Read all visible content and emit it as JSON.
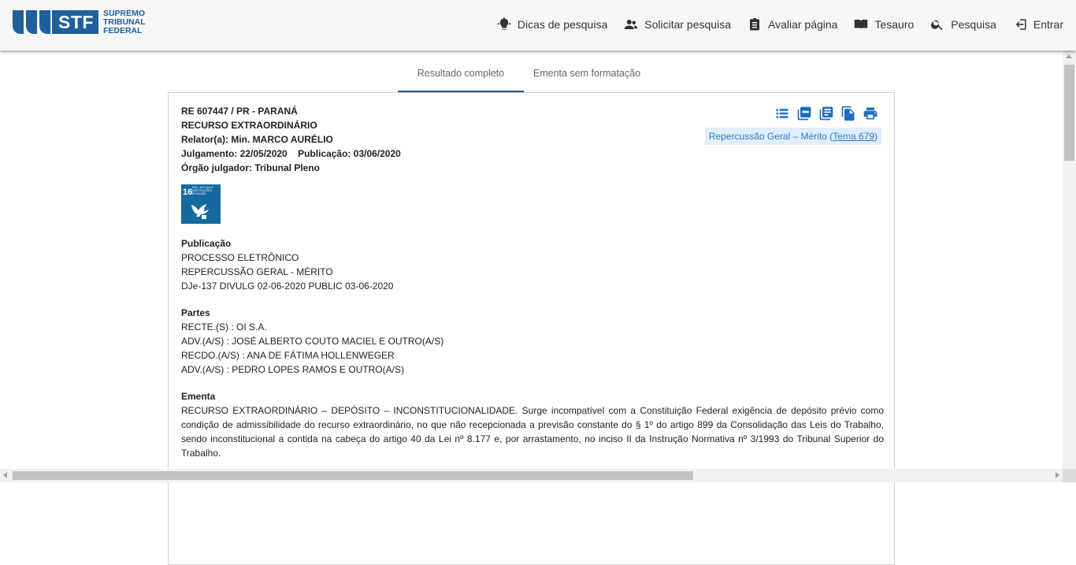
{
  "header": {
    "logo": {
      "abbr": "STF",
      "line1": "SUPREMO",
      "line2": "TRIBUNAL",
      "line3": "FEDERAL",
      "color": "#1f5f9e"
    },
    "nav": [
      {
        "label": "Dicas de pesquisa",
        "icon": "lightbulb-icon"
      },
      {
        "label": "Solicitar pesquisa",
        "icon": "people-icon"
      },
      {
        "label": "Avaliar página",
        "icon": "clipboard-icon"
      },
      {
        "label": "Tesauro",
        "icon": "book-icon"
      },
      {
        "label": "Pesquisa",
        "icon": "search-icon"
      },
      {
        "label": "Entrar",
        "icon": "login-icon"
      }
    ]
  },
  "tabs": [
    {
      "label": "Resultado completo",
      "active": true
    },
    {
      "label": "Ementa sem formatação",
      "active": false
    }
  ],
  "document": {
    "case": "RE 607447 / PR - PARANÁ",
    "type": "RECURSO EXTRAORDINÁRIO",
    "relator": "Relator(a): Min. MARCO AURÉLIO",
    "julgamento": "Julgamento: 22/05/2020",
    "publicacao_date": "Publicação: 03/06/2020",
    "orgao": "Órgão julgador: Tribunal Pleno",
    "ods": {
      "number": "16",
      "label": "PAZ, JUSTIÇA E INSTITUIÇÕES EFICAZES",
      "icon": "dove-icon",
      "color": "#136a9f"
    },
    "badge": {
      "text": "Repercussão Geral – Mérito (",
      "link": "Tema 679",
      "close": ")"
    },
    "actions": [
      "list-icon",
      "pdf-icon",
      "document-icon",
      "copy-icon",
      "print-icon"
    ],
    "publicacao": {
      "title": "Publicação",
      "lines": [
        "PROCESSO ELETRÔNICO",
        "REPERCUSSÃO GERAL - MÉRITO",
        "DJe-137  DIVULG 02-06-2020  PUBLIC 03-06-2020"
      ]
    },
    "partes": {
      "title": "Partes",
      "lines": [
        "RECTE.(S)  : OI S.A.",
        "ADV.(A/S)  : JOSÉ ALBERTO COUTO MACIEL E OUTRO(A/S)",
        "RECDO.(A/S)  : ANA DE FÁTIMA HOLLENWEGER",
        "ADV.(A/S)  : PEDRO LOPES RAMOS E OUTRO(A/S)"
      ]
    },
    "ementa": {
      "title": "Ementa",
      "text": "RECURSO EXTRAORDINÁRIO – DEPÓSITO – INCONSTITUCIONALIDADE. Surge incompatível com a Constituição Federal exigência de depósito prévio como condição de admissibilidade do recurso extraordinário, no que não recepcionada a previsão constante do § 1º do artigo 899 da Consolidação das Leis do Trabalho, sendo inconstitucional a contida na cabeça do artigo 40 da Lei nº 8.177 e, por arrastamento, no inciso II da Instrução Normativa nº 3/1993 do Tribunal Superior do Trabalho."
    }
  }
}
